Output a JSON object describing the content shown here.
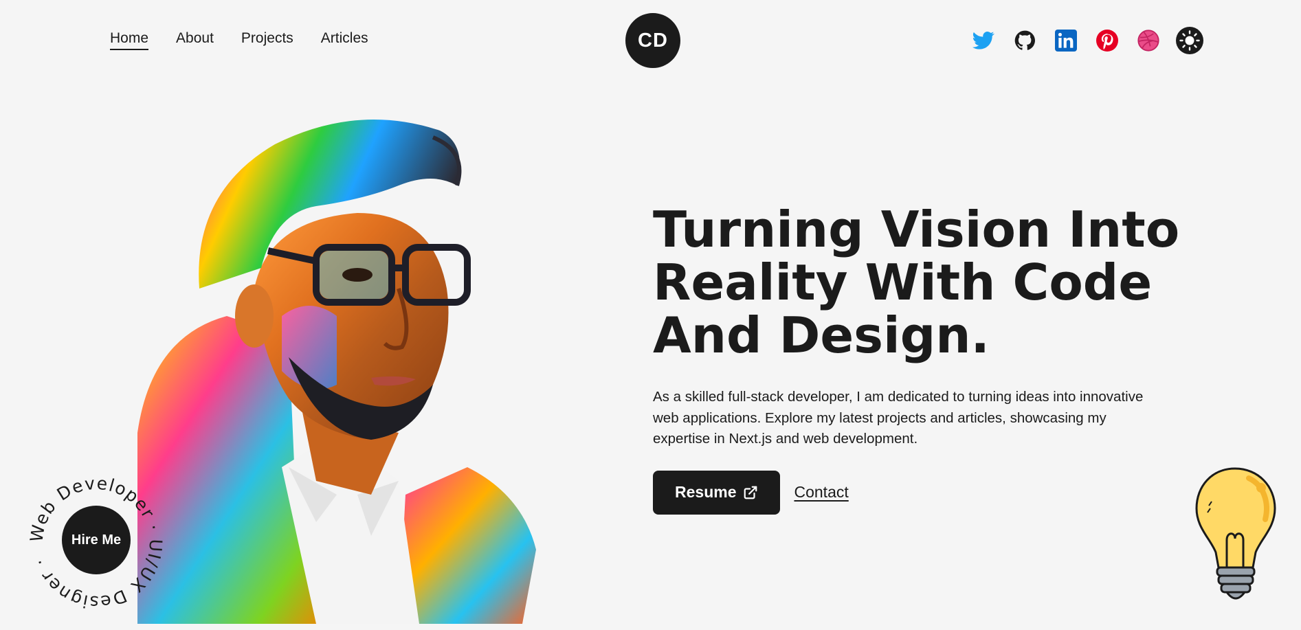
{
  "nav": {
    "links": [
      "Home",
      "About",
      "Projects",
      "Articles"
    ],
    "active": "Home",
    "logo_text": "CD"
  },
  "socials": [
    {
      "name": "twitter-icon",
      "color": "#1DA1F2"
    },
    {
      "name": "github-icon",
      "color": "#1b1b1b"
    },
    {
      "name": "linkedin-icon",
      "color": "#0A66C2"
    },
    {
      "name": "pinterest-icon",
      "color": "#E60023"
    },
    {
      "name": "dribbble-icon",
      "color": "#EA4C89"
    },
    {
      "name": "theme-toggle-sun-icon",
      "color": "#1b1b1b"
    }
  ],
  "hero": {
    "headline": "Turning Vision Into Reality With Code And Design.",
    "blurb": "As a skilled full-stack developer, I am dedicated to turning ideas into innovative web applications. Explore my latest projects and articles, showcasing my expertise in Next.js and web development.",
    "resume_label": "Resume",
    "contact_label": "Contact"
  },
  "hire": {
    "button_label": "Hire Me",
    "ring_text": "Web Developer · UI/UX Designer · "
  },
  "colors": {
    "background": "#f5f5f5",
    "dark": "#1b1b1b",
    "bulb_yellow": "#FFD966"
  }
}
